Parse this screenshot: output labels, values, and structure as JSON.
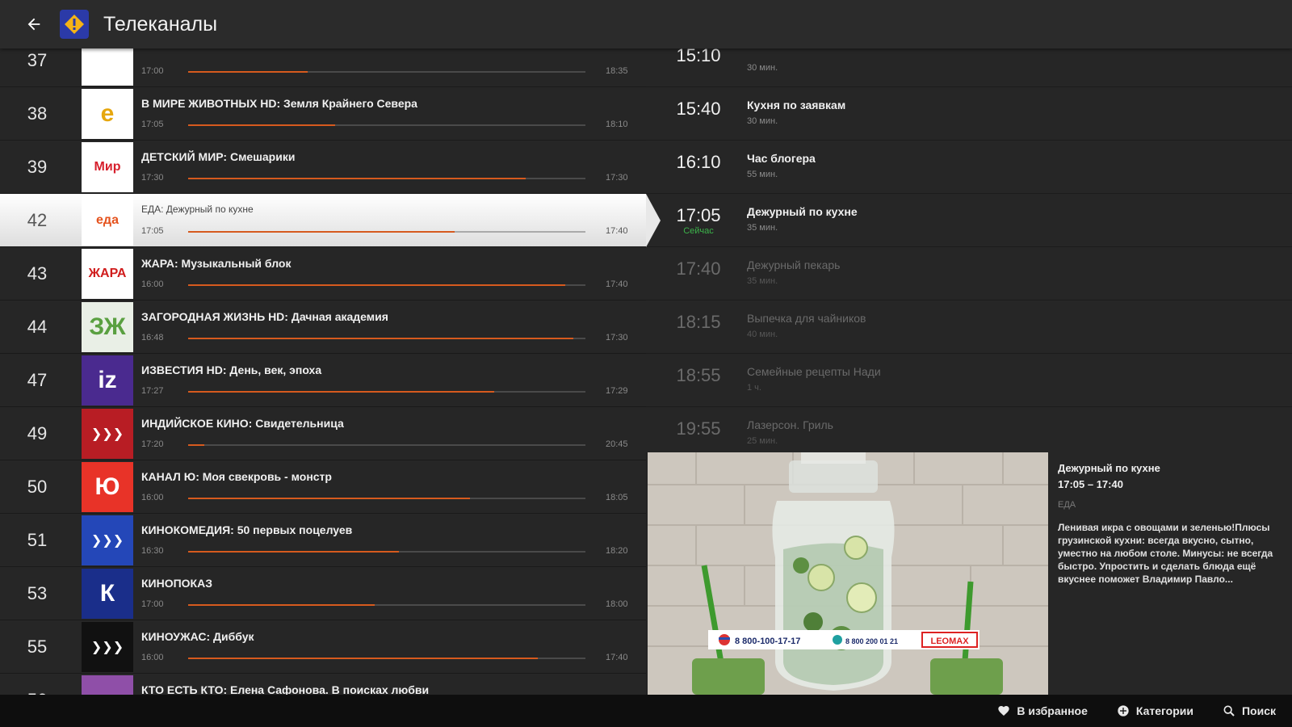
{
  "header": {
    "title": "Телеканалы"
  },
  "channels": [
    {
      "num": "37",
      "title": "",
      "start": "17:00",
      "end": "18:35",
      "progress": 0.3,
      "logo": {
        "text": "",
        "bg": "#ffffff",
        "fg": "#4d7a2a"
      }
    },
    {
      "num": "38",
      "title": "В МИРЕ ЖИВОТНЫХ HD: Земля Крайнего Севера",
      "start": "17:05",
      "end": "18:10",
      "progress": 0.37,
      "logo": {
        "text": "e",
        "bg": "#ffffff",
        "fg": "#e6a70e"
      }
    },
    {
      "num": "39",
      "title": "ДЕТСКИЙ МИР: Смешарики",
      "start": "17:30",
      "end": "17:30",
      "progress": 0.85,
      "logo": {
        "text": "Мир",
        "bg": "#ffffff",
        "fg": "#d61f2c"
      }
    },
    {
      "num": "42",
      "title": "ЕДА: Дежурный по кухне",
      "start": "17:05",
      "end": "17:40",
      "progress": 0.67,
      "selected": true,
      "logo": {
        "text": "еда",
        "bg": "#ffffff",
        "fg": "#e5531e"
      }
    },
    {
      "num": "43",
      "title": "ЖАРА: Музыкальный блок",
      "start": "16:00",
      "end": "17:40",
      "progress": 0.95,
      "logo": {
        "text": "ЖАРА",
        "bg": "#ffffff",
        "fg": "#d01d1d"
      }
    },
    {
      "num": "44",
      "title": "ЗАГОРОДНАЯ ЖИЗНЬ HD: Дачная академия",
      "start": "16:48",
      "end": "17:30",
      "progress": 0.97,
      "logo": {
        "text": "ЗЖ",
        "bg": "#e9efe6",
        "fg": "#5aa041"
      }
    },
    {
      "num": "47",
      "title": "ИЗВЕСТИЯ HD: День, век, эпоха",
      "start": "17:27",
      "end": "17:29",
      "progress": 0.77,
      "logo": {
        "text": "iz",
        "bg": "#4a2a8f",
        "fg": "#ffffff"
      }
    },
    {
      "num": "49",
      "title": "ИНДИЙСКОЕ КИНО: Свидетельница",
      "start": "17:20",
      "end": "20:45",
      "progress": 0.04,
      "logo": {
        "text": "❯❯❯",
        "bg": "#b81d24",
        "fg": "#ffffff"
      }
    },
    {
      "num": "50",
      "title": "КАНАЛ Ю: Моя свекровь - монстр",
      "start": "16:00",
      "end": "18:05",
      "progress": 0.71,
      "logo": {
        "text": "Ю",
        "bg": "#e83328",
        "fg": "#ffffff"
      }
    },
    {
      "num": "51",
      "title": "КИНОКОМЕДИЯ: 50 первых поцелуев",
      "start": "16:30",
      "end": "18:20",
      "progress": 0.53,
      "logo": {
        "text": "❯❯❯",
        "bg": "#2447b8",
        "fg": "#ffffff"
      }
    },
    {
      "num": "53",
      "title": "КИНОПОКАЗ",
      "start": "17:00",
      "end": "18:00",
      "progress": 0.47,
      "logo": {
        "text": "К",
        "bg": "#1a2e8a",
        "fg": "#ffffff"
      }
    },
    {
      "num": "55",
      "title": "КИНОУЖАС: Диббук",
      "start": "16:00",
      "end": "17:40",
      "progress": 0.88,
      "logo": {
        "text": "❯❯❯",
        "bg": "#111111",
        "fg": "#ffffff"
      }
    },
    {
      "num": "56",
      "title": "КТО ЕСТЬ КТО: Елена Сафонова. В поисках любви",
      "start": "",
      "end": "",
      "progress": 0,
      "logo": {
        "text": "",
        "bg": "#8f4fa8",
        "fg": "#ffffff"
      }
    }
  ],
  "schedule": [
    {
      "time": "15:10",
      "title": "",
      "duration": "30 мин.",
      "state": "past"
    },
    {
      "time": "15:40",
      "title": "Кухня по заявкам",
      "duration": "30 мин.",
      "state": "past"
    },
    {
      "time": "16:10",
      "title": "Час блогера",
      "duration": "55 мин.",
      "state": "past"
    },
    {
      "time": "17:05",
      "title": "Дежурный по кухне",
      "duration": "35 мин.",
      "state": "now",
      "now_label": "Сейчас"
    },
    {
      "time": "17:40",
      "title": "Дежурный пекарь",
      "duration": "35 мин.",
      "state": "future"
    },
    {
      "time": "18:15",
      "title": "Выпечка для чайников",
      "duration": "40 мин.",
      "state": "future"
    },
    {
      "time": "18:55",
      "title": "Семейные рецепты Нади",
      "duration": "1 ч.",
      "state": "future"
    },
    {
      "time": "19:55",
      "title": "Лазерсон. Гриль",
      "duration": "25 мин.",
      "state": "future"
    }
  ],
  "preview": {
    "phone1": "8 800-100-17-17",
    "phone2": "8 800 200 01 21",
    "brand": "LEOMAX"
  },
  "info": {
    "title": "Дежурный по кухне",
    "time": "17:05 – 17:40",
    "channel": "ЕДА",
    "description": "Ленивая икра с овощами и зеленью!Плюсы грузинской кухни: всегда вкусно, сытно, уместно на любом столе. Минусы: не всегда быстро. Упростить и сделать блюда ещё вкуснее поможет Владимир Павло..."
  },
  "bottom": {
    "favorites": "В избранное",
    "categories": "Категории",
    "search": "Поиск"
  },
  "colors": {
    "accent": "#d65a1e",
    "now": "#3cb34a"
  }
}
